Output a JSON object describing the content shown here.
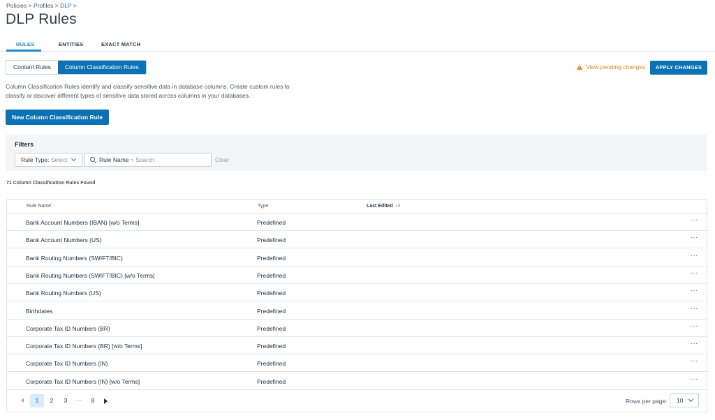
{
  "breadcrumb": {
    "items": [
      "Policies",
      "Profiles",
      "DLP"
    ],
    "separator": ">"
  },
  "page_title": "DLP Rules",
  "tabs": [
    {
      "label": "RULES",
      "active": true
    },
    {
      "label": "ENTITIES",
      "active": false
    },
    {
      "label": "EXACT MATCH",
      "active": false
    }
  ],
  "segment": {
    "content_rules": "Content Rules",
    "column_classification_rules": "Column Classification Rules"
  },
  "pending": {
    "label": "View pending changes",
    "icon": "warning-icon"
  },
  "apply_button": "APPLY CHANGES",
  "description": "Column Classification Rules identify and classify sensitive data in database columns. Create custom rules to classify or discover different types of sensitive data stored across columns in your databases.",
  "new_rule_button": "New Column Classification Rule",
  "filters": {
    "title": "Filters",
    "rule_type_label": "Rule Type:",
    "rule_type_value": "Select",
    "rule_name_label": "Rule Name",
    "rule_name_operator": "~",
    "rule_name_placeholder": "Search",
    "clear_label": "Clear"
  },
  "results_count": "71 Column Classification Rules Found",
  "table": {
    "columns": [
      "Rule Name",
      "Type",
      "Last Edited"
    ],
    "rows": [
      {
        "name": "Bank Account Numbers (IBAN) [w/o Terms]",
        "type": "Predefined",
        "last_edited": ""
      },
      {
        "name": "Bank Account Numbers (US)",
        "type": "Predefined",
        "last_edited": ""
      },
      {
        "name": "Bank Routing Numbers (SWIFT/BIC)",
        "type": "Predefined",
        "last_edited": ""
      },
      {
        "name": "Bank Routing Numbers (SWIFT/BIC) [w/o Terms]",
        "type": "Predefined",
        "last_edited": ""
      },
      {
        "name": "Bank Routing Numbers (US)",
        "type": "Predefined",
        "last_edited": ""
      },
      {
        "name": "Birthdates",
        "type": "Predefined",
        "last_edited": ""
      },
      {
        "name": "Corporate Tax ID Numbers (BR)",
        "type": "Predefined",
        "last_edited": ""
      },
      {
        "name": "Corporate Tax ID Numbers (BR) [w/o Terms]",
        "type": "Predefined",
        "last_edited": ""
      },
      {
        "name": "Corporate Tax ID Numbers (IN)",
        "type": "Predefined",
        "last_edited": ""
      },
      {
        "name": "Corporate Tax ID Numbers (IN) [w/o Terms]",
        "type": "Predefined",
        "last_edited": ""
      }
    ],
    "row_action": "···"
  },
  "pagination": {
    "pages": [
      "1",
      "2",
      "3",
      "···",
      "8"
    ],
    "current_page": "1",
    "rows_per_page_label": "Rows per page:",
    "rows_per_page_value": "10"
  },
  "colors": {
    "primary": "#0a72b5",
    "tab_active": "#1a87c9",
    "warning": "#e8861a",
    "link": "#1a73c8"
  }
}
